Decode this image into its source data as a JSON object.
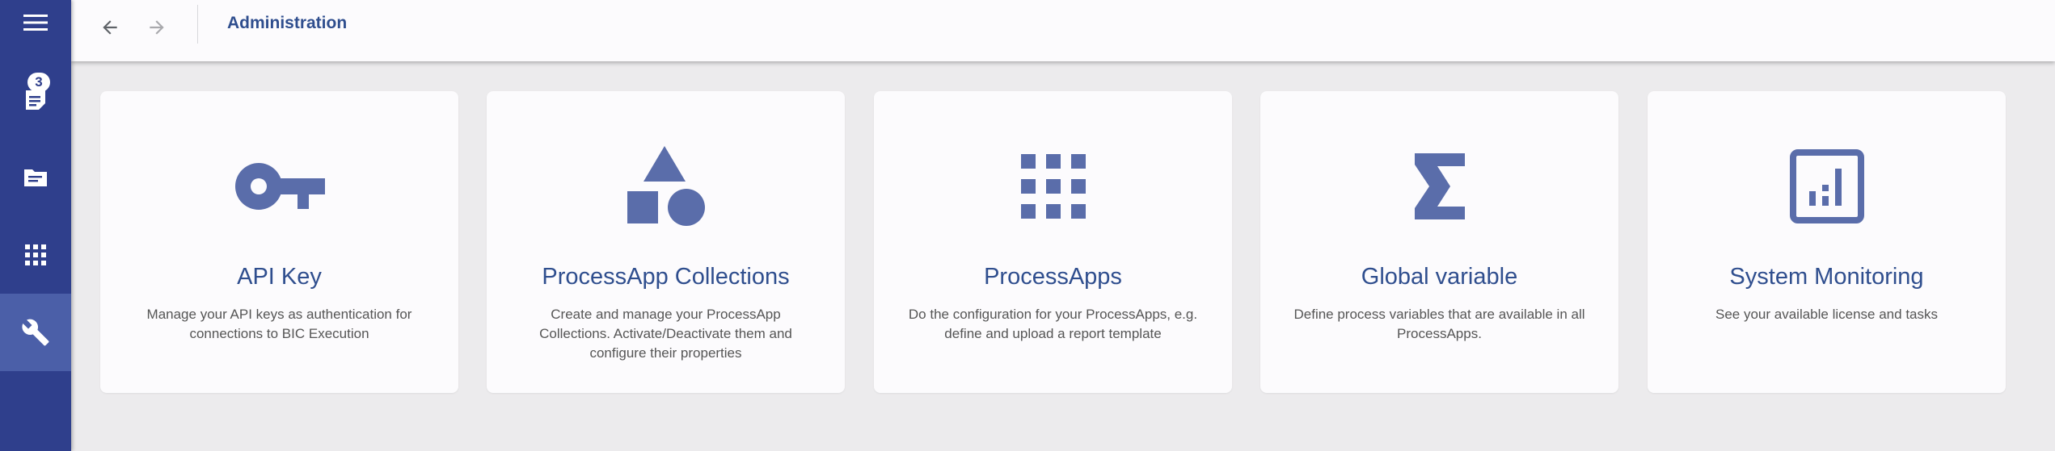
{
  "sidebar": {
    "items": [
      {
        "icon": "menu-icon"
      },
      {
        "icon": "tasks-icon",
        "badge": "3"
      },
      {
        "icon": "folder-icon"
      },
      {
        "icon": "apps-grid-icon"
      },
      {
        "icon": "wrench-icon",
        "active": true
      }
    ]
  },
  "header": {
    "title": "Administration"
  },
  "cards": [
    {
      "icon": "key-icon",
      "title": "API Key",
      "description": "Manage your API keys as authentication for connections to BIC Execution"
    },
    {
      "icon": "shapes-icon",
      "title": "ProcessApp Collections",
      "description": "Create and manage your ProcessApp Collections. Activate/Deactivate them and configure their properties"
    },
    {
      "icon": "apps-grid-icon",
      "title": "ProcessApps",
      "description": "Do the configuration for your ProcessApps, e.g. define and upload a report template"
    },
    {
      "icon": "sigma-icon",
      "title": "Global variable",
      "description": "Define process variables that are available in all ProcessApps."
    },
    {
      "icon": "monitoring-icon",
      "title": "System Monitoring",
      "description": "See your available license and tasks"
    }
  ],
  "colors": {
    "sidebar": "#2f3f8c",
    "sidebar_active": "#4b5fa8",
    "accent": "#2f4e8e",
    "icon": "#5a6daa",
    "background": "#ecebed",
    "card": "#fcfbfd"
  }
}
